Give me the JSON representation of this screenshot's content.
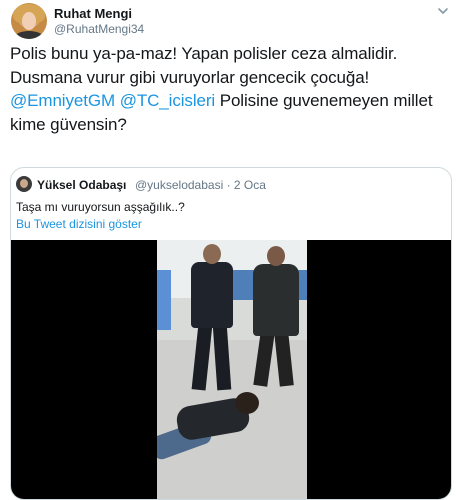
{
  "tweet": {
    "author_name": "Ruhat Mengi",
    "author_handle": "@RuhatMengi34",
    "text_line_1": "Polis bunu ya-pa-maz! Yapan polisler ceza almalidir.",
    "text_line_2": "Dusmana vurur gibi vuruyorlar gencecik çocuğa!",
    "mention_1": "@EmniyetGM",
    "mention_2": "@TC_icisleri",
    "text_line_3_rest": " Polisine guvenemeyen millet",
    "text_line_4": "kime güvensin?"
  },
  "quoted_tweet": {
    "author_name": "Yüksel Odabaşı",
    "author_handle": "@yukselodabasi · 2 Oca",
    "text": "Taşa mı vuruyorsun aşşağılık..?",
    "thread_link": "Bu Tweet dizisini göster"
  },
  "icons": {
    "menu": "chevron-down-icon"
  },
  "colors": {
    "link": "#1b95e0",
    "secondary_text": "#657786",
    "border": "#cfd9de"
  }
}
